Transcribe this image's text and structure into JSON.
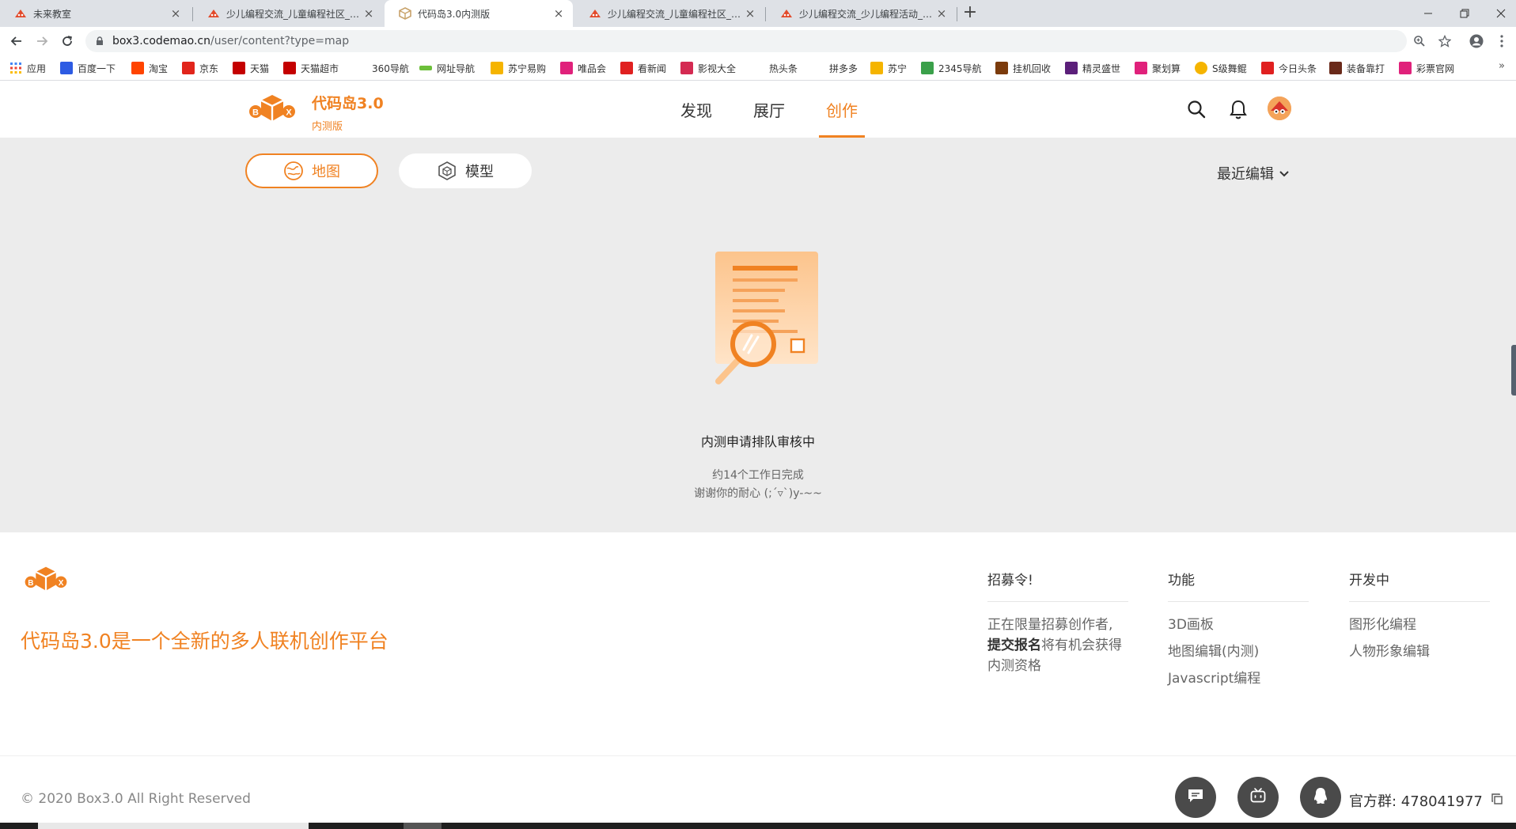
{
  "browser": {
    "tabs": [
      {
        "title": "未来教室"
      },
      {
        "title": "少儿编程交流_儿童编程社区_scr"
      },
      {
        "title": "代码岛3.0内测版"
      },
      {
        "title": "少儿编程交流_儿童编程社区_scr"
      },
      {
        "title": "少儿编程交流_少儿编程活动_scr"
      }
    ],
    "url_host": "box3.codemao.cn",
    "url_path": "/user/content?type=map",
    "bookmarks": [
      {
        "label": "应用",
        "color": "#4285f4"
      },
      {
        "label": "百度一下",
        "color": "#2d5be3"
      },
      {
        "label": "淘宝",
        "color": "#ff4400"
      },
      {
        "label": "京东",
        "color": "#e1251b"
      },
      {
        "label": "天猫",
        "color": "#c40000"
      },
      {
        "label": "天猫超市",
        "color": "#c40000"
      },
      {
        "label": "360导航",
        "color": ""
      },
      {
        "label": "网址导航",
        "color": "#6cbf3a"
      },
      {
        "label": "苏宁易购",
        "color": "#f5b400"
      },
      {
        "label": "唯品会",
        "color": "#e0217b"
      },
      {
        "label": "看新闻",
        "color": "#e02020"
      },
      {
        "label": "影视大全",
        "color": "#d42a52"
      },
      {
        "label": "热头条",
        "color": ""
      },
      {
        "label": "拼多多",
        "color": ""
      },
      {
        "label": "苏宁",
        "color": "#f5b400"
      },
      {
        "label": "2345导航",
        "color": "#3aa04a"
      },
      {
        "label": "挂机回收",
        "color": "#7b3b0c"
      },
      {
        "label": "精灵盛世",
        "color": "#5b1f7a"
      },
      {
        "label": "聚划算",
        "color": "#e0217b"
      },
      {
        "label": "S级舞鲲",
        "color": "#f5b400"
      },
      {
        "label": "今日头条",
        "color": "#e02020"
      },
      {
        "label": "装备靠打",
        "color": "#6a2a1a"
      },
      {
        "label": "彩票官网",
        "color": "#e0217b"
      }
    ],
    "more": "»"
  },
  "header": {
    "brand_name": "代码岛3.0",
    "brand_beta": "内测版",
    "nav": [
      {
        "label": "发现"
      },
      {
        "label": "展厅"
      },
      {
        "label": "创作"
      }
    ]
  },
  "main": {
    "tabs": [
      {
        "label": "地图"
      },
      {
        "label": "模型"
      }
    ],
    "sort_label": "最近编辑",
    "status_title": "内测申请排队审核中",
    "status_line1": "约14个工作日完成",
    "status_line2": "谢谢你的耐心 (;´▿`)y-~~"
  },
  "footer": {
    "tagline": "代码岛3.0是一个全新的多人联机创作平台",
    "columns": {
      "recruit": {
        "heading": "招募令!",
        "text_before": "正在限量招募创作者,",
        "text_bold": "提交报名",
        "text_after": "将有机会获得内测资格"
      },
      "features": {
        "heading": "功能",
        "links": [
          "3D画板",
          "地图编辑(内测)",
          "Javascript编程"
        ]
      },
      "dev": {
        "heading": "开发中",
        "links": [
          "图形化编程",
          "人物形象编辑"
        ]
      }
    },
    "copyright": "© 2020 Box3.0 All Right Reserved",
    "qq_group": "官方群:  478041977"
  },
  "colors": {
    "accent": "#f08222",
    "main_bg": "#ececec",
    "circle_btn": "#4a4a4a"
  }
}
